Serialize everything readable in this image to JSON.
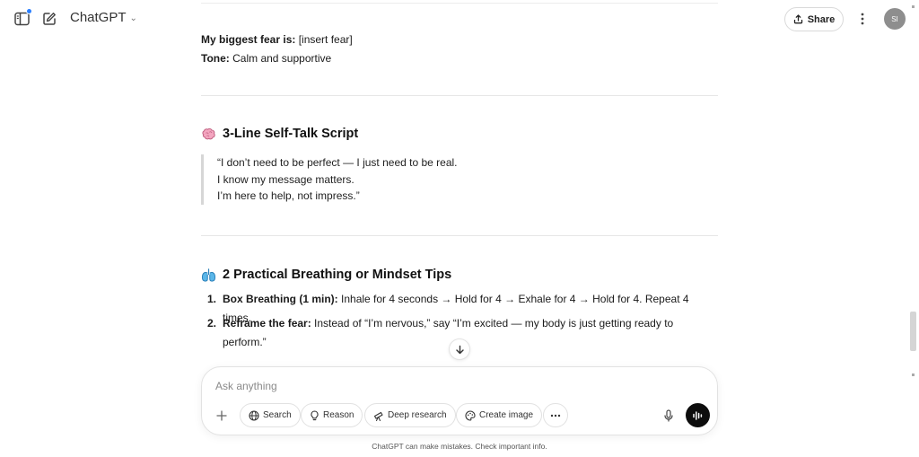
{
  "header": {
    "model_name": "ChatGPT",
    "share_label": "Share",
    "avatar_initials": "SI"
  },
  "message": {
    "fear_label": "My biggest fear is:",
    "fear_value": " [insert fear]",
    "tone_label": "Tone:",
    "tone_value": " Calm and supportive",
    "section1_title": "3-Line Self-Talk Script",
    "quote_lines": [
      "“I don’t need to be perfect — I just need to be real.",
      "I know my message matters.",
      "I’m here to help, not impress.”"
    ],
    "section2_title": "2 Practical Breathing or Mindset Tips",
    "tips": [
      {
        "num": "1.",
        "title": "Box Breathing (1 min):",
        "text": " Inhale for 4 seconds → Hold for 4 → Exhale for 4 → Hold for 4. Repeat 4 times."
      },
      {
        "num": "2.",
        "title": "Reframe the fear:",
        "text": " Instead of “I’m nervous,” say “I’m excited — my body is just getting ready to",
        "text2": "perform.”"
      }
    ]
  },
  "composer": {
    "placeholder": "Ask anything",
    "tools": [
      {
        "label": "Search",
        "icon": "globe-icon"
      },
      {
        "label": "Reason",
        "icon": "lightbulb-icon"
      },
      {
        "label": "Deep research",
        "icon": "telescope-icon"
      },
      {
        "label": "Create image",
        "icon": "palette-icon"
      }
    ]
  },
  "footer": {
    "disclaimer": "ChatGPT can make mistakes. Check important info."
  },
  "colors": {
    "accent_dot": "#2b7fff",
    "voice_button": "#0d0d0d",
    "avatar_bg": "#8e8e8e"
  }
}
